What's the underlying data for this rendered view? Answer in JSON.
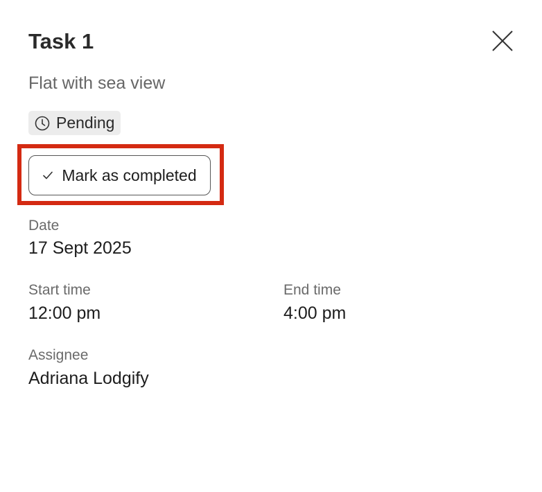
{
  "task": {
    "title": "Task 1",
    "property": "Flat with sea view",
    "status": "Pending",
    "status_icon": "clock-icon",
    "close_icon": "close-icon"
  },
  "actions": {
    "mark_completed_label": "Mark as completed",
    "mark_completed_icon": "check-icon"
  },
  "fields": {
    "date_label": "Date",
    "date_value": "17 Sept 2025",
    "start_time_label": "Start time",
    "start_time_value": "12:00 pm",
    "end_time_label": "End time",
    "end_time_value": "4:00 pm",
    "assignee_label": "Assignee",
    "assignee_value": "Adriana Lodgify"
  },
  "colors": {
    "highlight": "#d42a12",
    "badge_bg": "#ececec"
  }
}
